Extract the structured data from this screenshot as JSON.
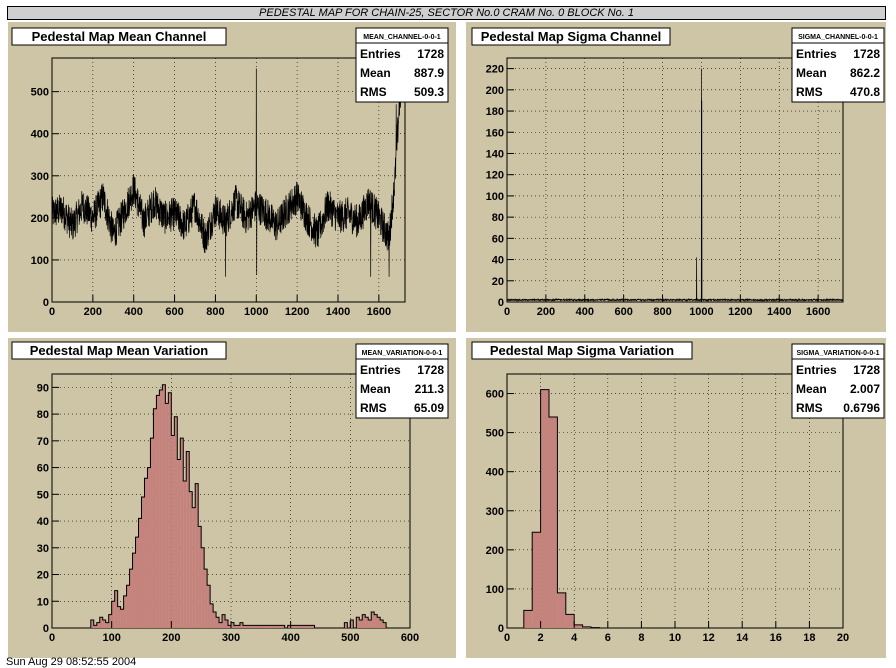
{
  "page_title": "PEDESTAL MAP FOR CHAIN-25, SECTOR No.0 CRAM No. 0 BLOCK No. 1",
  "footer": "Sun Aug 29 08:52:55 2004",
  "colors": {
    "background": "#cdc5a5",
    "frame": "#ffffff",
    "fill": "#c4837c",
    "line": "#000000",
    "grid": "#000000"
  },
  "chart_data": [
    {
      "type": "line",
      "title": "Pedestal Map Mean Channel",
      "xlim": [
        0,
        1728
      ],
      "ylim": [
        0,
        580
      ],
      "xticks": [
        0,
        200,
        400,
        600,
        800,
        1000,
        1200,
        1400,
        1600
      ],
      "yticks": [
        0,
        100,
        200,
        300,
        400,
        500
      ],
      "stats": {
        "name": "MEAN_CHANNEL-0-0-1",
        "entries_label": "Entries",
        "entries": "1728",
        "mean_label": "Mean",
        "mean": "887.9",
        "rms_label": "RMS",
        "rms": "509.3"
      },
      "baseline": 205,
      "noise": 40,
      "spikes": [
        [
          1000,
          555
        ],
        [
          1002,
          65
        ],
        [
          850,
          60
        ],
        [
          1560,
          60
        ],
        [
          1650,
          60
        ],
        [
          1685,
          470
        ],
        [
          1700,
          560
        ]
      ],
      "x": [
        0,
        50,
        100,
        150,
        200,
        250,
        300,
        350,
        400,
        450,
        500,
        550,
        600,
        650,
        700,
        750,
        800,
        850,
        900,
        950,
        1000,
        1050,
        1100,
        1150,
        1200,
        1250,
        1300,
        1350,
        1400,
        1450,
        1500,
        1550,
        1600,
        1650,
        1680,
        1700,
        1728
      ],
      "values": [
        210,
        220,
        180,
        230,
        200,
        250,
        160,
        210,
        270,
        190,
        240,
        200,
        210,
        180,
        230,
        150,
        220,
        190,
        240,
        200,
        230,
        210,
        180,
        220,
        250,
        200,
        160,
        230,
        200,
        210,
        190,
        240,
        200,
        150,
        300,
        470,
        560
      ]
    },
    {
      "type": "line",
      "title": "Pedestal Map Sigma Channel",
      "xlim": [
        0,
        1728
      ],
      "ylim": [
        0,
        230
      ],
      "xticks": [
        0,
        200,
        400,
        600,
        800,
        1000,
        1200,
        1400,
        1600
      ],
      "yticks": [
        0,
        20,
        40,
        60,
        80,
        100,
        120,
        140,
        160,
        180,
        200,
        220
      ],
      "stats": {
        "name": "SIGMA_CHANNEL-0-0-1",
        "entries_label": "Entries",
        "entries": "1728",
        "mean_label": "Mean",
        "mean": "862.2",
        "rms_label": "RMS",
        "rms": "470.8"
      },
      "baseline": 2,
      "noise": 1.5,
      "spikes": [
        [
          975,
          42
        ],
        [
          1000,
          220
        ],
        [
          1002,
          190
        ]
      ]
    },
    {
      "type": "bar",
      "title": "Pedestal Map Mean Variation",
      "xlim": [
        0,
        600
      ],
      "ylim": [
        0,
        95
      ],
      "xticks": [
        0,
        100,
        200,
        300,
        400,
        500,
        600
      ],
      "yticks": [
        0,
        10,
        20,
        30,
        40,
        50,
        60,
        70,
        80,
        90
      ],
      "stats": {
        "name": "MEAN_VARIATION-0-0-1",
        "entries_label": "Entries",
        "entries": "1728",
        "mean_label": "Mean",
        "mean": "211.3",
        "rms_label": "RMS",
        "rms": "65.09"
      },
      "bin_start": 0,
      "bin_width": 5,
      "values": [
        0,
        0,
        0,
        0,
        0,
        0,
        0,
        0,
        0,
        0,
        0,
        0,
        0,
        3,
        1,
        2,
        4,
        3,
        2,
        5,
        10,
        14,
        8,
        7,
        12,
        16,
        22,
        28,
        34,
        41,
        49,
        56,
        60,
        71,
        82,
        87,
        89,
        91,
        84,
        88,
        72,
        79,
        63,
        71,
        55,
        66,
        51,
        45,
        54,
        38,
        30,
        22,
        16,
        9,
        6,
        4,
        2,
        5,
        3,
        1,
        2,
        1,
        1,
        2,
        1,
        1,
        1,
        1,
        1,
        1,
        1,
        1,
        1,
        1,
        1,
        1,
        1,
        1,
        0,
        1,
        1,
        1,
        1,
        1,
        1,
        1,
        1,
        1,
        0,
        0,
        0,
        0,
        0,
        0,
        0,
        0,
        0,
        0,
        0,
        0,
        0,
        0,
        0,
        0,
        0,
        0,
        0,
        0,
        0,
        0,
        0,
        0,
        0,
        0,
        0,
        0,
        0,
        0,
        0,
        0
      ],
      "tail": [
        [
          58,
          2
        ],
        [
          60,
          3
        ],
        [
          62,
          4
        ],
        [
          63,
          3
        ],
        [
          64,
          5
        ],
        [
          65,
          4
        ],
        [
          66,
          3
        ],
        [
          67,
          6
        ],
        [
          68,
          5
        ],
        [
          69,
          4
        ],
        [
          70,
          3
        ],
        [
          71,
          2
        ]
      ]
    },
    {
      "type": "bar",
      "title": "Pedestal Map Sigma Variation",
      "xlim": [
        0,
        20
      ],
      "ylim": [
        0,
        650
      ],
      "xticks": [
        0,
        2,
        4,
        6,
        8,
        10,
        12,
        14,
        16,
        18,
        20
      ],
      "yticks": [
        0,
        100,
        200,
        300,
        400,
        500,
        600
      ],
      "stats": {
        "name": "SIGMA_VARIATION-0-0-1",
        "entries_label": "Entries",
        "entries": "1728",
        "mean_label": "Mean",
        "mean": "2.007",
        "rms_label": "RMS",
        "rms": "0.6796"
      },
      "bin_start": 0,
      "bin_width": 0.5,
      "values": [
        0,
        0,
        45,
        245,
        610,
        540,
        90,
        35,
        8,
        3,
        1,
        0,
        0,
        0,
        0,
        0,
        0,
        0,
        0,
        0,
        0,
        0,
        0,
        0,
        0,
        0,
        0,
        0,
        0,
        0,
        0,
        0,
        0,
        0,
        0,
        0,
        0,
        0,
        0,
        0
      ]
    }
  ]
}
